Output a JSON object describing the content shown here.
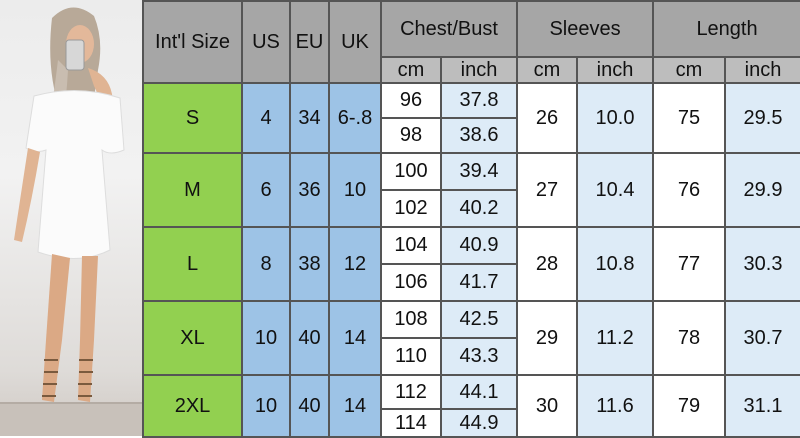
{
  "colors": {
    "header_bg": "#a6a6a6",
    "subheader_bg": "#bdbdbd",
    "size_col_bg": "#92d050",
    "us_eu_uk_bg": "#9dc3e6",
    "cm_bg": "#ffffff",
    "inch_bg": "#ddebf7"
  },
  "photo": {
    "icon": "model-photo"
  },
  "headers": {
    "intl_size": "Int'l Size",
    "us": "US",
    "eu": "EU",
    "uk": "UK",
    "chest_bust": "Chest/Bust",
    "sleeves": "Sleeves",
    "length": "Length"
  },
  "units": {
    "chest_cm": "cm",
    "chest_inch": "inch",
    "sleeves_cm": "cm",
    "sleeves_inch": "inch",
    "length_cm": "cm",
    "length_inch": "inch"
  },
  "rows": [
    {
      "size": "S",
      "us": "4",
      "eu": "34",
      "uk": "6-.8",
      "chest": [
        {
          "cm": "96",
          "inch": "37.8"
        },
        {
          "cm": "98",
          "inch": "38.6"
        }
      ],
      "sleeves_cm": "26",
      "sleeves_inch": "10.0",
      "length_cm": "75",
      "length_inch": "29.5"
    },
    {
      "size": "M",
      "us": "6",
      "eu": "36",
      "uk": "10",
      "chest": [
        {
          "cm": "100",
          "inch": "39.4"
        },
        {
          "cm": "102",
          "inch": "40.2"
        }
      ],
      "sleeves_cm": "27",
      "sleeves_inch": "10.4",
      "length_cm": "76",
      "length_inch": "29.9"
    },
    {
      "size": "L",
      "us": "8",
      "eu": "38",
      "uk": "12",
      "chest": [
        {
          "cm": "104",
          "inch": "40.9"
        },
        {
          "cm": "106",
          "inch": "41.7"
        }
      ],
      "sleeves_cm": "28",
      "sleeves_inch": "10.8",
      "length_cm": "77",
      "length_inch": "30.3"
    },
    {
      "size": "XL",
      "us": "10",
      "eu": "40",
      "uk": "14",
      "chest": [
        {
          "cm": "108",
          "inch": "42.5"
        },
        {
          "cm": "110",
          "inch": "43.3"
        }
      ],
      "sleeves_cm": "29",
      "sleeves_inch": "11.2",
      "length_cm": "78",
      "length_inch": "30.7"
    },
    {
      "size": "2XL",
      "us": "10",
      "eu": "40",
      "uk": "14",
      "chest": [
        {
          "cm": "112",
          "inch": "44.1"
        },
        {
          "cm": "114",
          "inch": "44.9"
        }
      ],
      "sleeves_cm": "30",
      "sleeves_inch": "11.6",
      "length_cm": "79",
      "length_inch": "31.1"
    }
  ]
}
